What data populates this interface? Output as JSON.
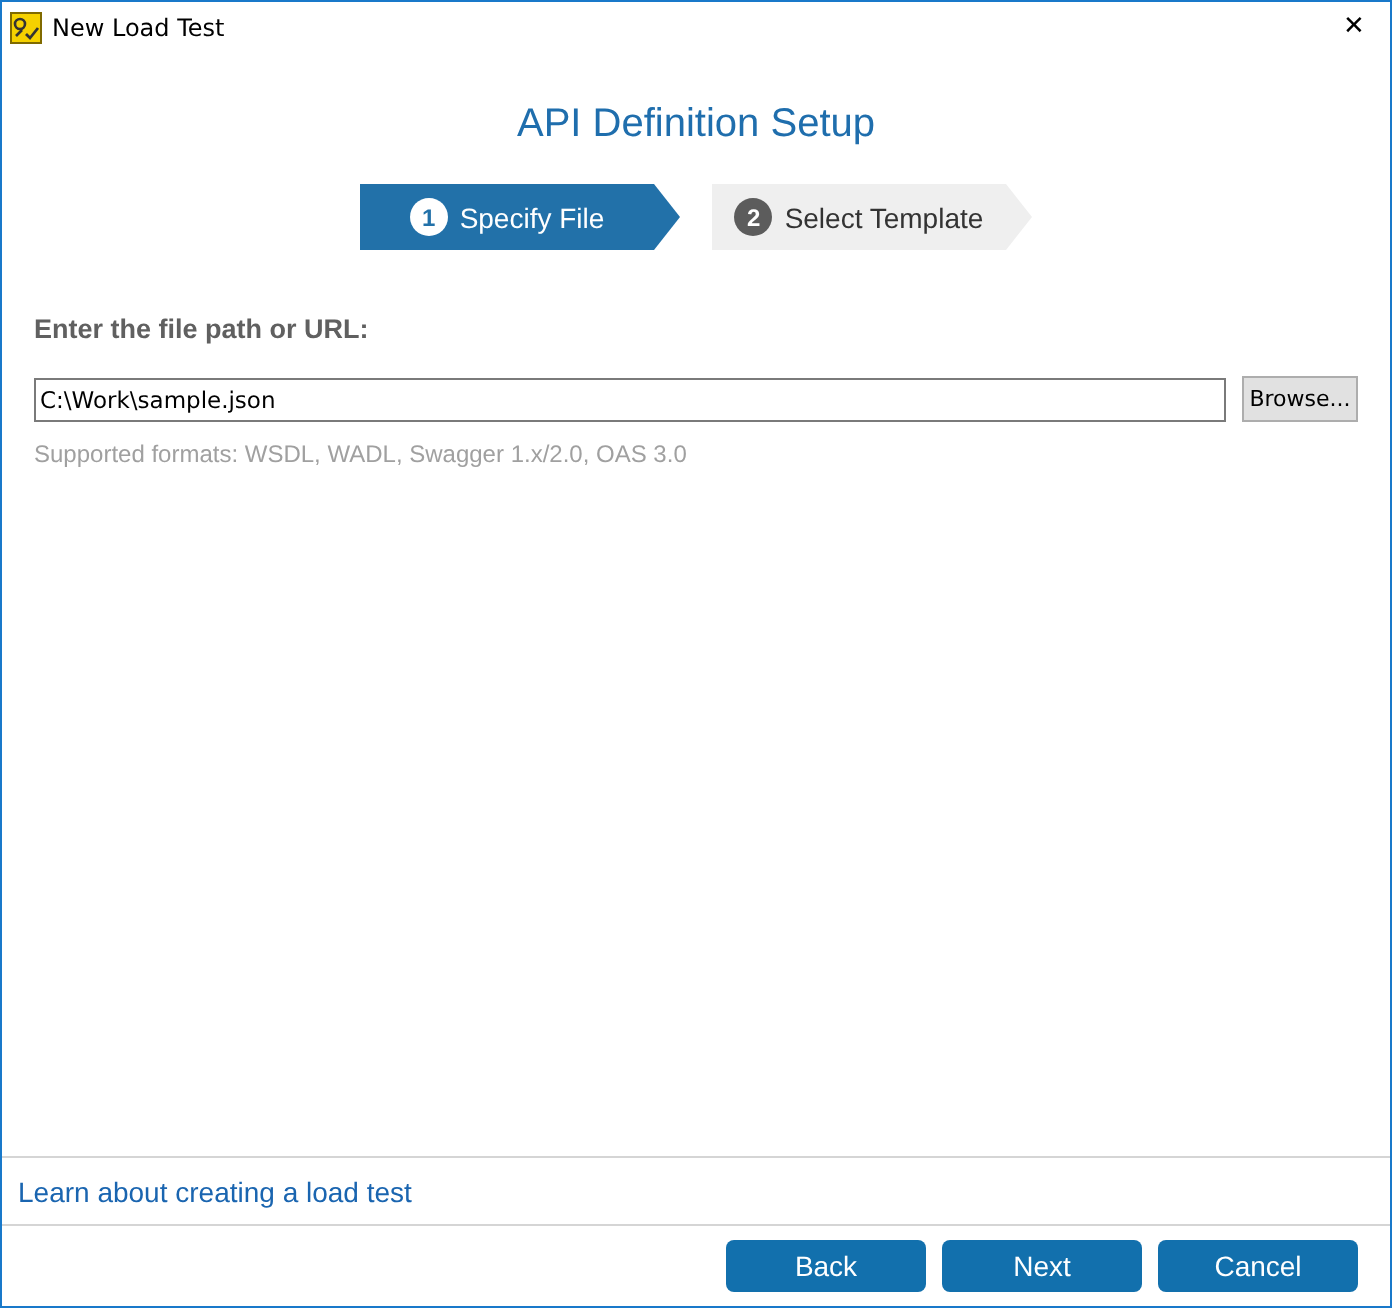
{
  "window": {
    "title": "New Load Test",
    "close": "✕"
  },
  "heading": "API Definition Setup",
  "steps": [
    {
      "number": "1",
      "label": "Specify File",
      "selected": true
    },
    {
      "number": "2",
      "label": "Select Template",
      "selected": false
    }
  ],
  "file_field": {
    "label": "Enter the file path or URL:",
    "value": "C:\\Work\\sample.json",
    "browse": "Browse...",
    "hint": "Supported formats: WSDL, WADL, Swagger 1.x/2.0, OAS 3.0"
  },
  "help_link": "Learn about creating a load test",
  "buttons": [
    "Back",
    "Next",
    "Cancel"
  ]
}
